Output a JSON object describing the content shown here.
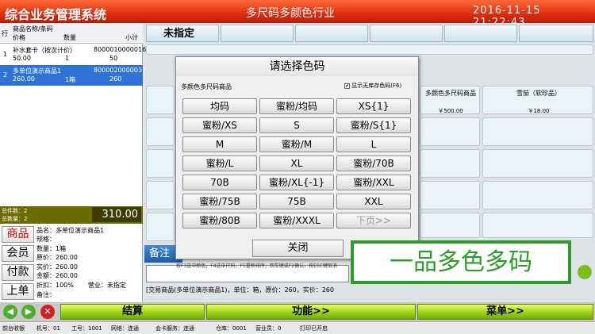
{
  "header": {
    "system_title": "综合业务管理系统",
    "industry": "多尺码多颜色行业",
    "datetime": "2016-11-15  21:22:43"
  },
  "cart": {
    "col_row": "行",
    "col_name": "商品名称/条码",
    "col_price": "价格",
    "col_qty": "数量",
    "col_subtotal": "小计",
    "rows": [
      {
        "no": "1",
        "name": "补水套卡（按次计价）",
        "barcode": "8000010000016",
        "price": "50.00",
        "qty": "1",
        "subtotal": "50",
        "selected": false
      },
      {
        "no": "2",
        "name": "多单位演示商品1",
        "barcode": "8000020000037",
        "price": "260.00",
        "qty": "1箱",
        "subtotal": "260",
        "selected": true
      }
    ],
    "total_qty": "总件数：2",
    "total_kinds": "总数量：2",
    "total_amount": "310.00"
  },
  "side_nav": [
    "商品",
    "会员",
    "付款",
    "上单"
  ],
  "detail": {
    "name_label": "品名：",
    "name_value": "多单位演示商品1",
    "spec_label": "规格：",
    "qty_label": "数量：",
    "qty_value": "1箱",
    "orig_label": "原价：",
    "orig_value": "260.00",
    "price_label": "实价：",
    "price_value": "260.00",
    "amount_label": "金额：",
    "amount_value": "260.00",
    "discount_label": "折扣：",
    "discount_value": "100%",
    "sales_label": "营业：",
    "sales_value": "未指定",
    "memo_label": "备注："
  },
  "grid": {
    "unassigned": "未指定",
    "products": [
      {
        "name": "多颜色多尺码商品",
        "price": "￥500.00"
      },
      {
        "name": "雪茄（软珍品）",
        "price": "￥18.00"
      }
    ],
    "memo_label": "备注",
    "status_line": "[交易商品(多单位演示商品1)，单位：箱，原价：260，实价：260"
  },
  "dialog": {
    "title": "请选择色码",
    "product": "多颜色多尺码商品",
    "show_label": "显示无库存色码(F6)",
    "show_checked": "✔",
    "codes": [
      "均码",
      "蜜粉/均码",
      "XS{1}",
      "蜜粉/XS",
      "S",
      "蜜粉/S{1}",
      "M",
      "蜜粉/M",
      "L",
      "蜜粉/L",
      "XL",
      "蜜粉/70B",
      "70B",
      "蜜粉/XL{-1}",
      "蜜粉/XXL",
      "蜜粉/75B",
      "75B",
      "XXL",
      "蜜粉/80B",
      "蜜粉/XXXL",
      "下页>>"
    ],
    "close": "关闭",
    "hint": "按F3选中颜色，F4选中尺码，F5重新排序，回车键或F2确认，按ESC键取消"
  },
  "banner": "一品多色多码",
  "bottom": {
    "checkout": "结算",
    "functions": "功能>>",
    "menu": "菜单>>"
  },
  "footer": {
    "front": "前台收银",
    "machine": "机号：01",
    "staff": "工号：1001",
    "network": "网络：连通",
    "member_service": "会卡服务：连通",
    "warehouse": "仓库：0001",
    "sales": "营业员：0",
    "printer": "打印已开启"
  },
  "colors": {
    "top_bar": "#e02e10",
    "selected_row": "#2f73d6",
    "button_green": "#9fd31a",
    "banner_green": "#2e9c2a",
    "total_bar": "#6b6b00"
  }
}
